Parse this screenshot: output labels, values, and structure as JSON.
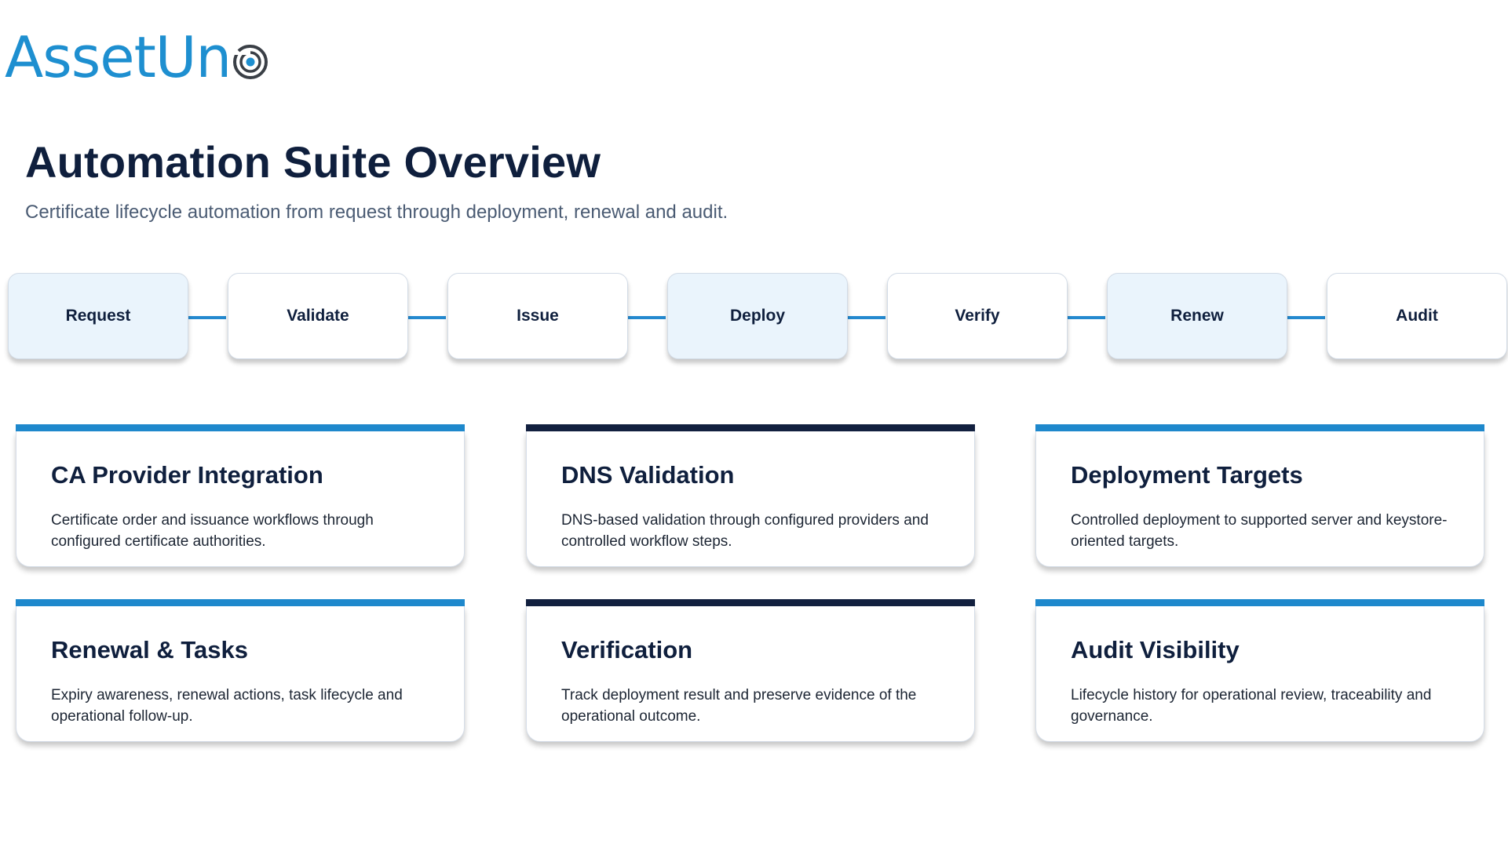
{
  "brand": {
    "name_prefix": "AssetUn",
    "logo_mark_icon": "target-o-icon",
    "color": "#1e8fd0"
  },
  "header": {
    "title": "Automation Suite Overview",
    "subtitle": "Certificate lifecycle automation from request through deployment, renewal and audit."
  },
  "workflow": {
    "connector_color": "#2489cf",
    "steps": [
      {
        "label": "Request",
        "highlighted": true
      },
      {
        "label": "Validate",
        "highlighted": false
      },
      {
        "label": "Issue",
        "highlighted": false
      },
      {
        "label": "Deploy",
        "highlighted": true
      },
      {
        "label": "Verify",
        "highlighted": false
      },
      {
        "label": "Renew",
        "highlighted": true
      },
      {
        "label": "Audit",
        "highlighted": false
      }
    ]
  },
  "cards": [
    {
      "title": "CA Provider Integration",
      "description": "Certificate order and issuance workflows through configured certificate authorities.",
      "accent": "#1e88cc"
    },
    {
      "title": "DNS Validation",
      "description": "DNS-based validation through configured providers and controlled workflow steps.",
      "accent": "#12203f"
    },
    {
      "title": "Deployment Targets",
      "description": "Controlled deployment to supported server and keystore-oriented targets.",
      "accent": "#1e88cc"
    },
    {
      "title": "Renewal & Tasks",
      "description": "Expiry awareness, renewal actions, task lifecycle and operational follow-up.",
      "accent": "#1e88cc"
    },
    {
      "title": "Verification",
      "description": "Track deployment result and preserve evidence of the operational outcome.",
      "accent": "#12203f"
    },
    {
      "title": "Audit Visibility",
      "description": "Lifecycle history for operational review, traceability and governance.",
      "accent": "#1e88cc"
    }
  ]
}
